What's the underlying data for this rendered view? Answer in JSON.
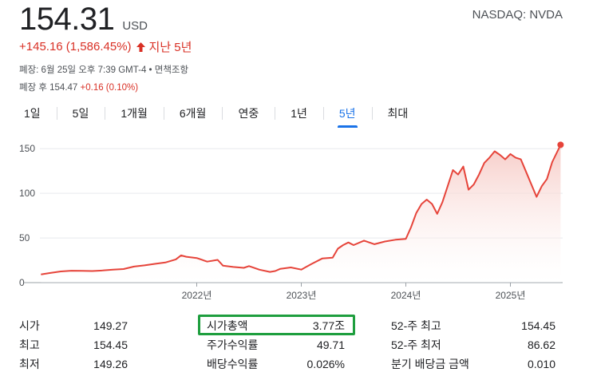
{
  "quote": {
    "price": "154.31",
    "currency": "USD",
    "exchange": "NASDAQ: NVDA",
    "change": "+145.16 (1,586.45%)",
    "period": "지난 5년",
    "close_info": "폐장: 6월 25일 오후 7:39 GMT-4 • 면책조항",
    "after_hours_prefix": "폐장 후 154.47",
    "after_hours_change": "+0.16 (0.10%)"
  },
  "tabs": [
    {
      "label": "1일",
      "active": false
    },
    {
      "label": "5일",
      "active": false
    },
    {
      "label": "1개월",
      "active": false
    },
    {
      "label": "6개월",
      "active": false
    },
    {
      "label": "연중",
      "active": false
    },
    {
      "label": "1년",
      "active": false
    },
    {
      "label": "5년",
      "active": true
    },
    {
      "label": "최대",
      "active": false
    }
  ],
  "chart_data": {
    "type": "area",
    "y_ticks": [
      0,
      50,
      100,
      150
    ],
    "ylim": [
      0,
      160
    ],
    "x_tick_labels": [
      "2022년",
      "2023년",
      "2024년",
      "2025년"
    ],
    "x_tick_years": [
      2022.0,
      2023.0,
      2024.0,
      2025.0
    ],
    "xlim": [
      2020.5,
      2025.5
    ],
    "line_color": "#e6443a",
    "fill_color": "#f6c9c4",
    "series": [
      {
        "x": [
          2020.51,
          2020.6,
          2020.7,
          2020.8,
          2020.9,
          2021.0,
          2021.1,
          2021.2,
          2021.3,
          2021.4,
          2021.5,
          2021.6,
          2021.7,
          2021.8,
          2021.85,
          2021.9,
          2022.0,
          2022.1,
          2022.2,
          2022.25,
          2022.35,
          2022.45,
          2022.5,
          2022.6,
          2022.7,
          2022.75,
          2022.8,
          2022.9,
          2023.0,
          2023.1,
          2023.2,
          2023.3,
          2023.35,
          2023.4,
          2023.45,
          2023.5,
          2023.6,
          2023.7,
          2023.8,
          2023.9,
          2024.0,
          2024.05,
          2024.1,
          2024.15,
          2024.2,
          2024.25,
          2024.3,
          2024.35,
          2024.4,
          2024.45,
          2024.5,
          2024.55,
          2024.6,
          2024.65,
          2024.7,
          2024.75,
          2024.8,
          2024.85,
          2024.9,
          2024.95,
          2025.0,
          2025.05,
          2025.1,
          2025.15,
          2025.2,
          2025.25,
          2025.3,
          2025.35,
          2025.4,
          2025.48
        ],
        "y": [
          9.2,
          10.8,
          12.5,
          13.3,
          13.1,
          13.0,
          13.6,
          14.5,
          15.2,
          18.0,
          19.3,
          21.0,
          22.5,
          26.0,
          30.5,
          29.0,
          27.5,
          23.5,
          25.5,
          19.0,
          17.5,
          16.5,
          18.5,
          14.5,
          12.0,
          13.0,
          15.5,
          17.0,
          14.6,
          21.0,
          27.0,
          28.0,
          38.0,
          42.0,
          45.0,
          42.0,
          47.0,
          43.0,
          46.0,
          48.0,
          49.0,
          62.0,
          78.0,
          88.0,
          93.0,
          88.0,
          77.0,
          90.0,
          108.0,
          126.0,
          121.0,
          130.0,
          104.0,
          110.0,
          121.0,
          134.0,
          140.0,
          147.0,
          143.0,
          138.0,
          144.0,
          140.0,
          138.0,
          124.0,
          110.0,
          96.0,
          108.0,
          116.0,
          135.0,
          154.31
        ]
      }
    ]
  },
  "stats": {
    "col1": [
      {
        "label": "시가",
        "value": "149.27"
      },
      {
        "label": "최고",
        "value": "154.45"
      },
      {
        "label": "최저",
        "value": "149.26"
      }
    ],
    "col2": [
      {
        "label": "시가총액",
        "value": "3.77조"
      },
      {
        "label": "주가수익률",
        "value": "49.71"
      },
      {
        "label": "배당수익률",
        "value": "0.026%"
      }
    ],
    "col3": [
      {
        "label": "52-주 최고",
        "value": "154.45"
      },
      {
        "label": "52-주 최저",
        "value": "86.62"
      },
      {
        "label": "분기 배당금 금액",
        "value": "0.010"
      }
    ]
  },
  "colors": {
    "highlight_box": "#1e9e3e",
    "accent": "#1a73e8",
    "negative_change": "#d93025"
  }
}
